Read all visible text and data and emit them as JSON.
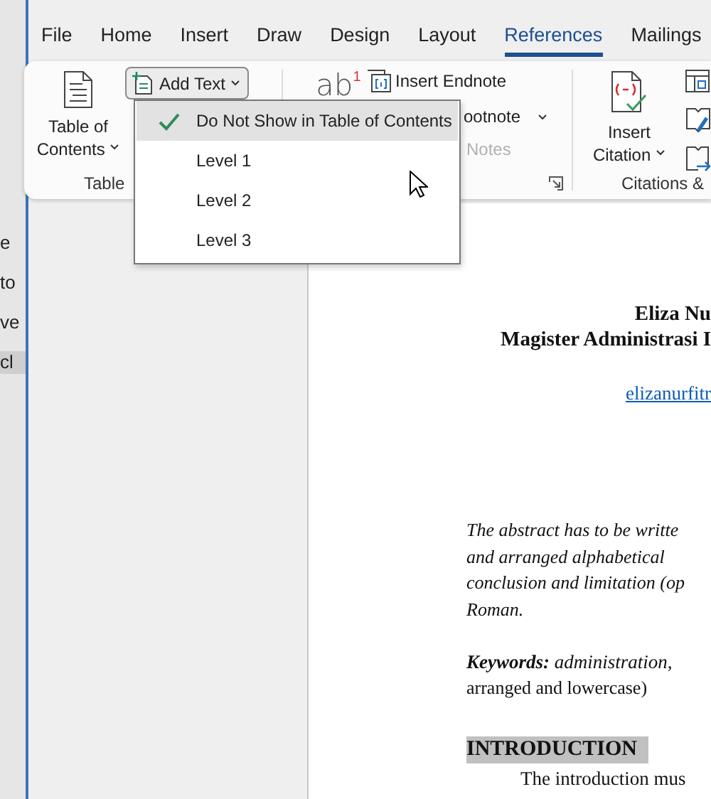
{
  "background_window": {
    "items": [
      {
        "label": "e",
        "selected": false
      },
      {
        "label": "to",
        "selected": false
      },
      {
        "label": "ve",
        "selected": false
      },
      {
        "label": "cl",
        "selected": true
      }
    ]
  },
  "tabs": [
    {
      "label": "File",
      "selected": false
    },
    {
      "label": "Home",
      "selected": false
    },
    {
      "label": "Insert",
      "selected": false
    },
    {
      "label": "Draw",
      "selected": false
    },
    {
      "label": "Design",
      "selected": false
    },
    {
      "label": "Layout",
      "selected": false
    },
    {
      "label": "References",
      "selected": true
    },
    {
      "label": "Mailings",
      "selected": false
    }
  ],
  "table_of_contents_group": {
    "toc_button": [
      "Table of",
      "Contents"
    ],
    "add_text_button": {
      "label": "Add Text",
      "expanded": true
    },
    "group_label": "Table"
  },
  "footnotes_group": {
    "footnote_icon": {
      "text": "ab",
      "superscript": "1"
    },
    "insert_endnote": "Insert Endnote",
    "footnote_fragment": "ootnote",
    "notes_fragment": {
      "label": "Notes",
      "disabled": true
    }
  },
  "citations_group": {
    "insert_citation": [
      "Insert",
      "Citation"
    ],
    "group_label": "Citations &"
  },
  "add_text_menu": {
    "items": [
      {
        "label": "Do Not Show in Table of Contents",
        "checked": true,
        "selected": true
      },
      {
        "label": "Level 1",
        "checked": false,
        "selected": false
      },
      {
        "label": "Level 2",
        "checked": false,
        "selected": false
      },
      {
        "label": "Level 3",
        "checked": false,
        "selected": false
      }
    ]
  },
  "document": {
    "author": "Eliza Nu",
    "affiliation": "Magister Administrasi I",
    "email": "elizanurfitr",
    "abstract_lines": [
      "The abstract has to be writte",
      "and  arranged  alphabetical",
      "conclusion and limitation (op",
      "Roman."
    ],
    "keywords": "**Keywords:** administration,",
    "keywords_continuation": "arranged and lowercase)",
    "heading": "INTRODUCTION",
    "paragraph": "The introduction mus"
  }
}
